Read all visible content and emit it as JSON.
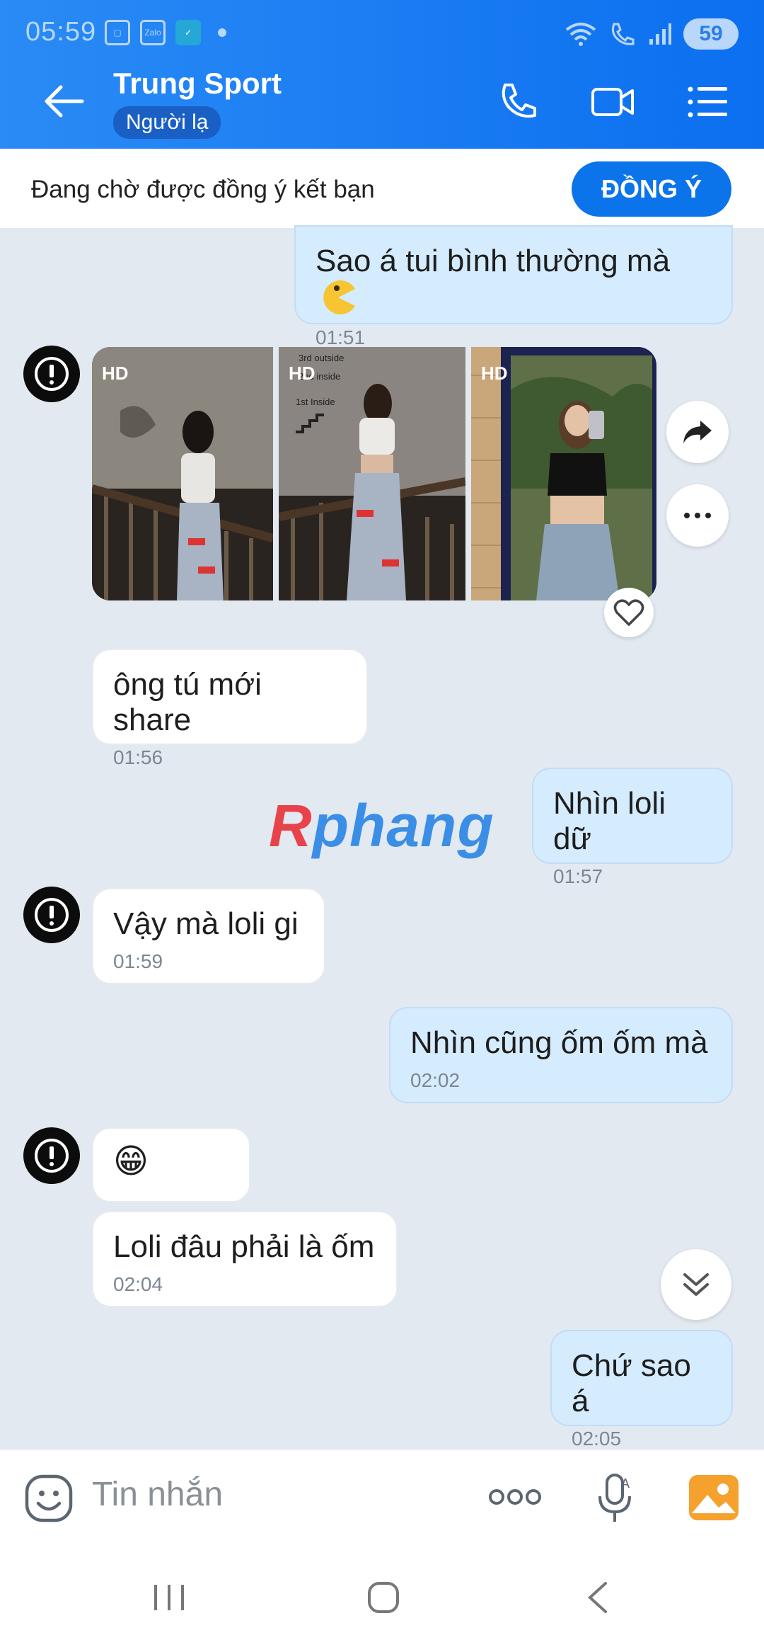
{
  "status_bar": {
    "time": "05:59",
    "battery": "59",
    "app_icon": "Zalo"
  },
  "header": {
    "name": "Trung Sport",
    "badge": "Người lạ"
  },
  "friend_request": {
    "text": "Đang chờ được đồng ý kết bạn",
    "button": "ĐỒNG Ý"
  },
  "messages": [
    {
      "text": "Sao á tui bình thường mà",
      "time": "01:51"
    },
    {
      "text": "ông tú mới share",
      "time": "01:56"
    },
    {
      "text": "Nhìn loli dữ",
      "time": "01:57"
    },
    {
      "text": "Vậy  mà loli gi",
      "time": "01:59"
    },
    {
      "text": "Nhìn cũng ốm ốm mà",
      "time": "02:02"
    },
    {
      "text": "😁"
    },
    {
      "text": "Loli đâu phải là ốm",
      "time": "02:04"
    },
    {
      "text": "Chứ sao á",
      "time": "02:05"
    }
  ],
  "photos": {
    "badge": "HD",
    "sign1": "3rd outside",
    "sign2": "2nd inside",
    "sign3": "1st Inside"
  },
  "watermark": {
    "first": "R",
    "rest": "phang"
  },
  "input": {
    "placeholder": "Tin nhắn"
  },
  "colors": {
    "header": "#0b6ff0",
    "my_bubble": "#d5ebfe",
    "their_bubble": "#ffffff",
    "background": "#e2e9f1"
  }
}
